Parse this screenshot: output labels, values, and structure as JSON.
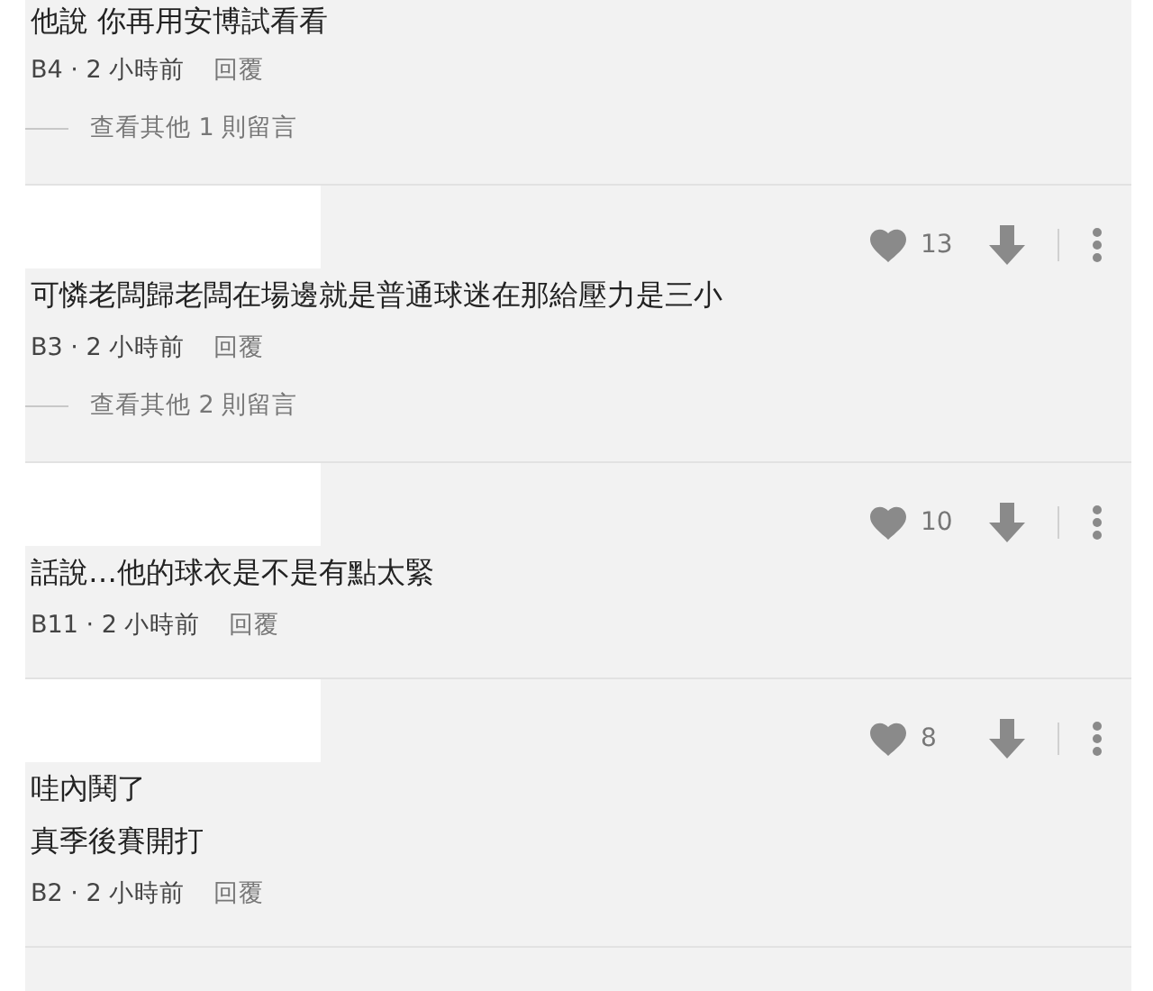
{
  "comments": [
    {
      "lines": [
        "他說 你再用安博試看看"
      ],
      "meta": "B4 · 2 小時前",
      "reply": "回覆",
      "more": "查看其他 1 則留言"
    },
    {
      "likes": "13",
      "lines": [
        "可憐老闆歸老闆在場邊就是普通球迷在那給壓力是三小"
      ],
      "meta": "B3 · 2 小時前",
      "reply": "回覆",
      "more": "查看其他 2 則留言"
    },
    {
      "likes": "10",
      "lines": [
        "話說…他的球衣是不是有點太緊"
      ],
      "meta": "B11 · 2 小時前",
      "reply": "回覆"
    },
    {
      "likes": "8",
      "lines": [
        "哇內鬨了",
        "真季後賽開打"
      ],
      "meta": "B2 · 2 小時前",
      "reply": "回覆"
    }
  ]
}
